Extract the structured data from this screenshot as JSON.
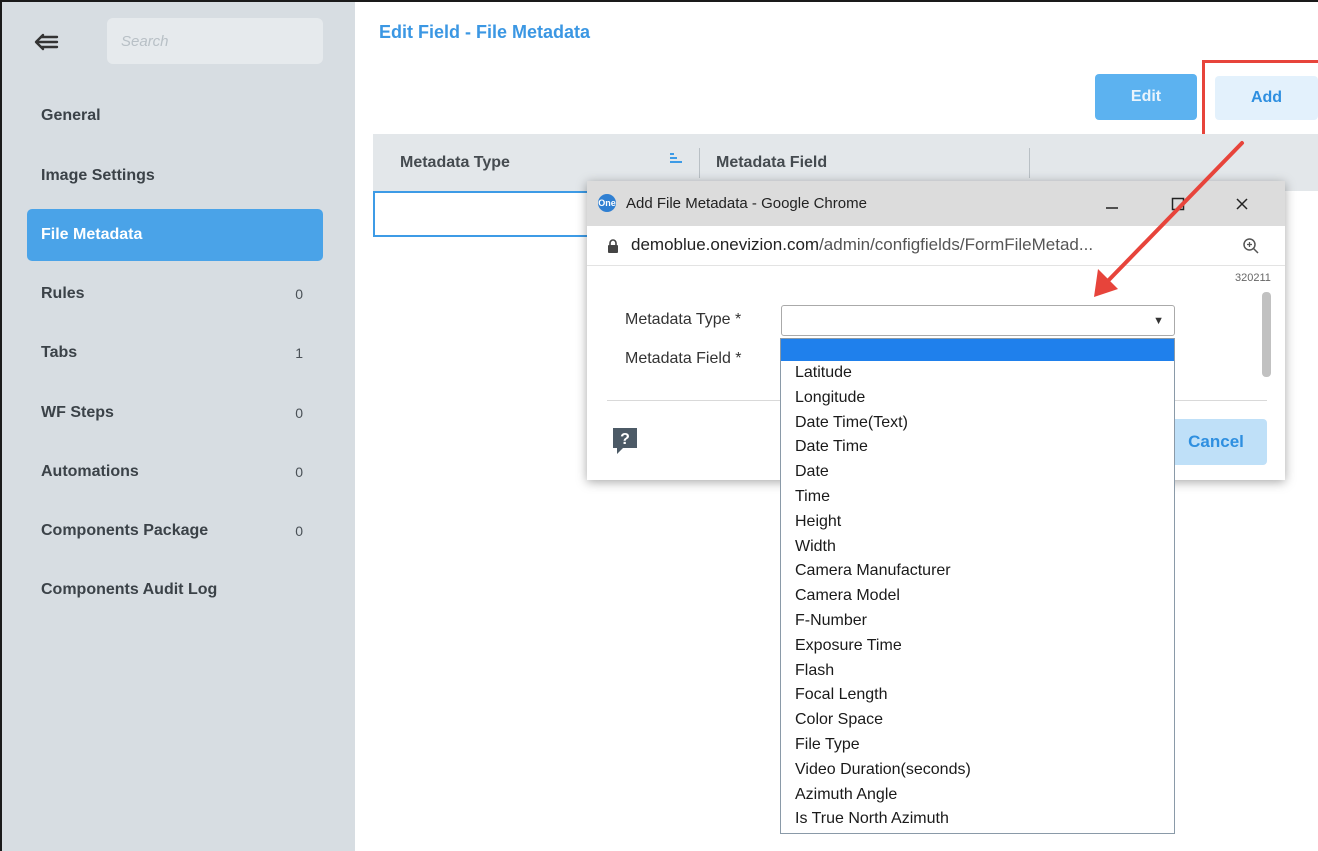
{
  "sidebar": {
    "search_placeholder": "Search",
    "items": [
      {
        "label": "General",
        "count": ""
      },
      {
        "label": "Image Settings",
        "count": ""
      },
      {
        "label": "File Metadata",
        "count": ""
      },
      {
        "label": "Rules",
        "count": "0"
      },
      {
        "label": "Tabs",
        "count": "1"
      },
      {
        "label": "WF Steps",
        "count": "0"
      },
      {
        "label": "Automations",
        "count": "0"
      },
      {
        "label": "Components Package",
        "count": "0"
      },
      {
        "label": "Components Audit Log",
        "count": ""
      }
    ],
    "active_index": 2
  },
  "main": {
    "title": "Edit Field - File Metadata",
    "edit_label": "Edit",
    "add_label": "Add",
    "grid": {
      "columns": [
        "Metadata Type",
        "Metadata Field"
      ]
    }
  },
  "popup": {
    "window_title": "Add File Metadata - Google Chrome",
    "url_host": "demoblue.onevizion.com",
    "url_path": "/admin/configfields/FormFileMetad...",
    "logo_text": "One",
    "version": "320211",
    "metadata_type_label": "Metadata Type *",
    "metadata_field_label": "Metadata Field *",
    "metadata_type_value": "",
    "cancel_label": "Cancel",
    "dropdown_options": [
      "Latitude",
      "Longitude",
      "Date Time(Text)",
      "Date Time",
      "Date",
      "Time",
      "Height",
      "Width",
      "Camera Manufacturer",
      "Camera Model",
      "F-Number",
      "Exposure Time",
      "Flash",
      "Focal Length",
      "Color Space",
      "File Type",
      "Video Duration(seconds)",
      "Azimuth Angle",
      "Is True North Azimuth"
    ]
  },
  "colors": {
    "accent": "#4aa3e8",
    "annotation": "#e7443b",
    "dropdown_highlight": "#1f80ec"
  }
}
